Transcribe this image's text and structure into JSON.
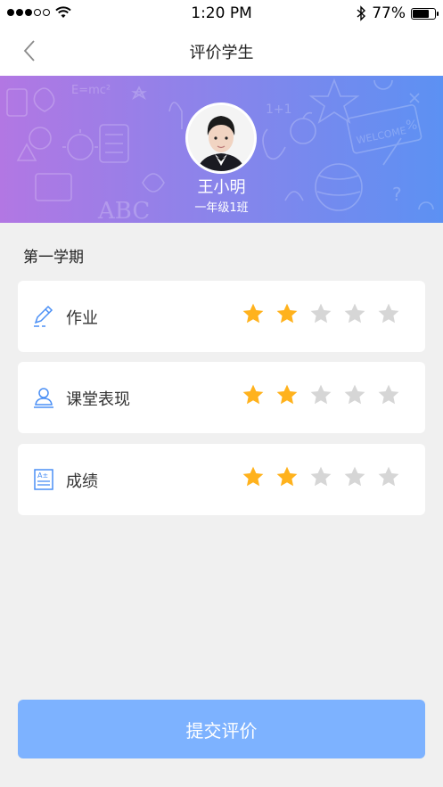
{
  "status_bar": {
    "time": "1:20 PM",
    "battery_text": "77%",
    "battery_level": 0.77,
    "signal_bars_filled": 3,
    "signal_bars_total": 5
  },
  "nav": {
    "title": "评价学生",
    "back_icon": "chevron-left-icon"
  },
  "student": {
    "name": "王小明",
    "class": "一年级1班"
  },
  "term": {
    "title": "第一学期"
  },
  "ratings": [
    {
      "icon": "pencil-icon",
      "label": "作业",
      "rating": 2,
      "max": 5
    },
    {
      "icon": "person-icon",
      "label": "课堂表现",
      "rating": 2,
      "max": 5
    },
    {
      "icon": "report-icon",
      "label": "成绩",
      "rating": 2,
      "max": 5
    }
  ],
  "submit": {
    "label": "提交评价"
  },
  "colors": {
    "star_active": "#ffb21d",
    "star_inactive": "#d6d6d6",
    "accent": "#4a8ff5",
    "submit_bg": "#7db2ff"
  }
}
